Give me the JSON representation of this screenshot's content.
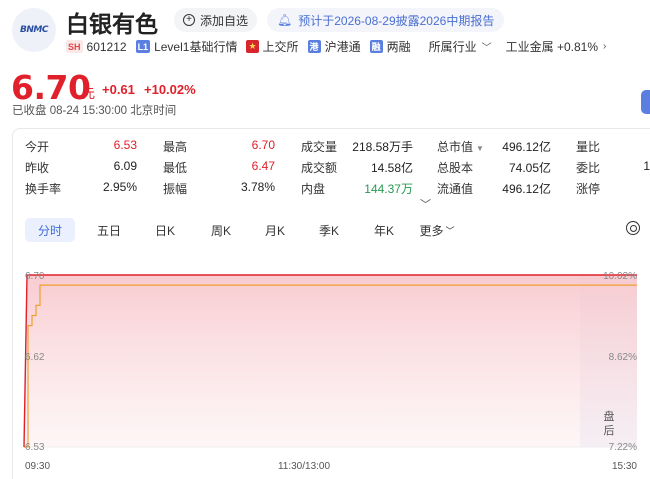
{
  "header": {
    "logo_text": "BNMC",
    "stock_name": "白银有色",
    "add_watchlist_label": "添加自选",
    "notice_text": "预计于2026-08-29披露2026中期报告",
    "exchange_tag": "SH",
    "stock_code": "601212",
    "level_tag": "L1",
    "level_label": "Level1基础行情",
    "exchange_label": "上交所",
    "hk_tag": "港",
    "hk_label": "沪港通",
    "margin_tag": "融",
    "margin_label": "两融",
    "industry_label": "所属行业",
    "sector_label": "工业金属 +0.81%"
  },
  "quote": {
    "price": "6.70",
    "unit": "元",
    "change": "+0.61",
    "change_pct": "+10.02%",
    "status": "已收盘 08-24 15:30:00 北京时间"
  },
  "stats": {
    "col1": [
      {
        "label": "今开",
        "value": "6.53",
        "color": "red"
      },
      {
        "label": "昨收",
        "value": "6.09",
        "color": "dark"
      },
      {
        "label": "换手率",
        "value": "2.95%",
        "color": "dark"
      }
    ],
    "col2": [
      {
        "label": "最高",
        "value": "6.70",
        "color": "red"
      },
      {
        "label": "最低",
        "value": "6.47",
        "color": "red"
      },
      {
        "label": "振幅",
        "value": "3.78%",
        "color": "dark"
      }
    ],
    "col3": [
      {
        "label": "成交量",
        "value": "218.58万手",
        "color": "dark"
      },
      {
        "label": "成交额",
        "value": "14.58亿",
        "color": "dark"
      },
      {
        "label": "内盘",
        "value": "144.37万",
        "color": "green"
      }
    ],
    "col4": [
      {
        "label": "总市值",
        "value": "496.12亿",
        "color": "dark"
      },
      {
        "label": "总股本",
        "value": "74.05亿",
        "color": "dark"
      },
      {
        "label": "流通值",
        "value": "496.12亿",
        "color": "dark"
      }
    ],
    "col5": [
      {
        "label": "量比",
        "value": "",
        "color": "dark"
      },
      {
        "label": "委比",
        "value": "1",
        "color": "dark"
      },
      {
        "label": "涨停",
        "value": "",
        "color": "dark"
      }
    ]
  },
  "tabs": [
    "分时",
    "五日",
    "日K",
    "周K",
    "月K",
    "季K",
    "年K",
    "更多"
  ],
  "chart_data": {
    "type": "line",
    "title": "",
    "y_left_ticks": [
      "6.70",
      "6.62",
      "6.53"
    ],
    "y_right_ticks": [
      "10.02%",
      "8.62%",
      "7.22%"
    ],
    "x_ticks": [
      "09:30",
      "11:30/13:00",
      "15:30"
    ],
    "ylim": [
      6.53,
      6.7
    ],
    "after_hours_label": [
      "盘",
      "后"
    ],
    "series": [
      {
        "values": [
          6.53,
          6.65,
          6.66,
          6.67,
          6.69,
          6.69,
          6.69,
          6.69,
          6.69,
          6.69,
          6.69,
          6.69,
          6.69
        ]
      },
      {
        "values": [
          6.53,
          6.7,
          6.7,
          6.7,
          6.7,
          6.7,
          6.7,
          6.7,
          6.7,
          6.7,
          6.7,
          6.7,
          6.7
        ]
      }
    ],
    "colors": {
      "price": "#e0202a",
      "avg": "#f0a030",
      "fill": "#fbe3e5",
      "after_hours": "#e9ecf8"
    }
  }
}
